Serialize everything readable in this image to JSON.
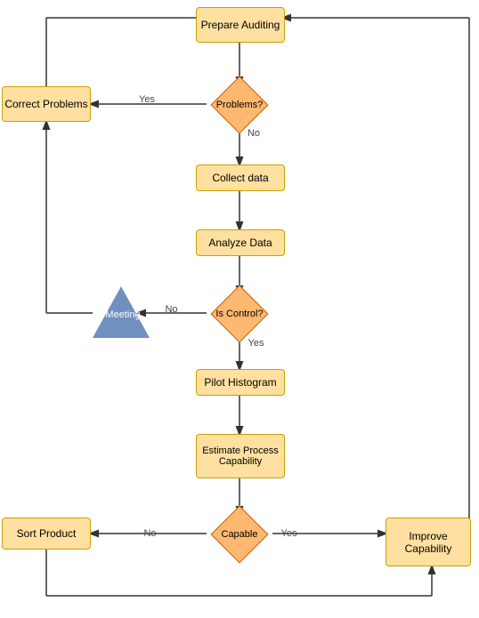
{
  "nodes": {
    "prepare_auditing": {
      "label": "Prepare Auditing"
    },
    "problems": {
      "label": "Problems?"
    },
    "correct_problems": {
      "label": "Correct Problems"
    },
    "collect_data": {
      "label": "Collect data"
    },
    "analyze_data": {
      "label": "Analyze Data"
    },
    "is_control": {
      "label": "Is Control?"
    },
    "meeting": {
      "label": "Meeting"
    },
    "pilot_histogram": {
      "label": "Pilot Histogram"
    },
    "estimate_process": {
      "label": "Estimate Process Capability"
    },
    "capable": {
      "label": "Capable"
    },
    "sort_product": {
      "label": "Sort Product"
    },
    "improve_capability": {
      "label": "Improve Capability"
    }
  },
  "labels": {
    "yes1": "Yes",
    "no1": "No",
    "no2": "No",
    "yes2": "Yes",
    "no3": "No",
    "yes3": "Yes"
  },
  "colors": {
    "rect_fill": "#FFE0A0",
    "rect_border": "#C8A000",
    "diamond_fill": "#FFB870",
    "diamond_border": "#C86000",
    "triangle_fill": "#7090C0",
    "line_color": "#333333"
  }
}
